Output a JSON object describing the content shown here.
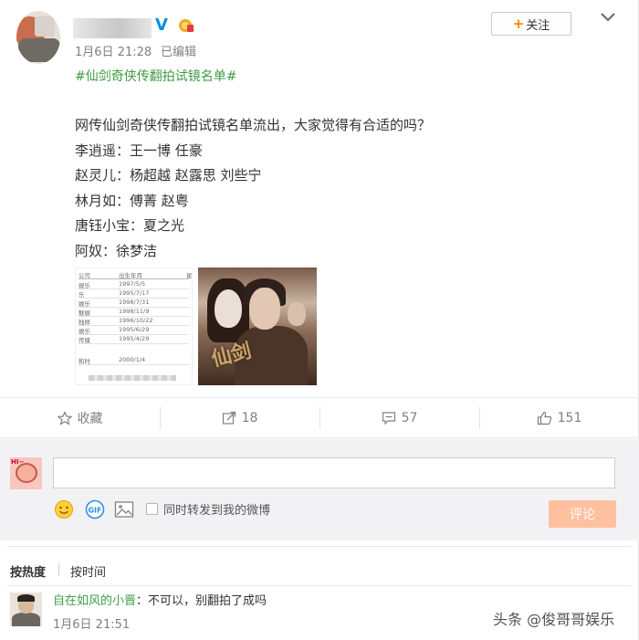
{
  "post": {
    "verified_badge": "V",
    "time": "1月6日 21:28",
    "edited": "已编辑",
    "follow_label": "关注",
    "follow_plus": "+",
    "topic": "#仙剑奇侠传翻拍试镜名单#",
    "lines": [
      "网传仙剑奇侠传翻拍试镜名单流出，大家觉得有合适的吗？",
      "李逍遥：王一博 任豪",
      "赵灵儿：杨超越 赵露思 刘些宁",
      "林月如：傅菁 赵粤",
      "唐钰小宝：夏之光",
      "阿奴：徐梦洁"
    ],
    "table_image": {
      "header": [
        "公司",
        "出生年月",
        "星"
      ],
      "rows": [
        [
          "娱乐",
          "1997/5/5"
        ],
        [
          "乐",
          "1995/7/17"
        ],
        [
          "娱乐",
          "1998/7/31"
        ],
        [
          "魅娱",
          "1998/11/9"
        ],
        [
          "独样",
          "1996/10/22"
        ],
        [
          "娱乐",
          "1995/6/29"
        ],
        [
          "传媒",
          "1995/4/29"
        ],
        [
          "和时",
          "2000/1/4"
        ]
      ]
    },
    "poster_calligraphy": "仙剑"
  },
  "actions": {
    "favorite_label": "收藏",
    "repost_count": "18",
    "comment_count": "57",
    "like_count": "151"
  },
  "composer": {
    "avatar_text": "HI~",
    "input_value": "",
    "repost_label": "同时转发到我的微博",
    "submit_label": "评论"
  },
  "comments": {
    "sort_hot": "按热度",
    "sort_time": "按时间",
    "items": [
      {
        "name": "自在如风的小晋",
        "colon": "：",
        "text": "不可以，别翻拍了成吗",
        "time": "1月6日 21:51"
      }
    ]
  },
  "watermark": "头条 @俊哥哥娱乐",
  "colors": {
    "topic_green": "#409c43",
    "follow_orange": "#ff8200",
    "submit_disabled": "#ffc09f",
    "verified_blue": "#0a8ce8"
  }
}
